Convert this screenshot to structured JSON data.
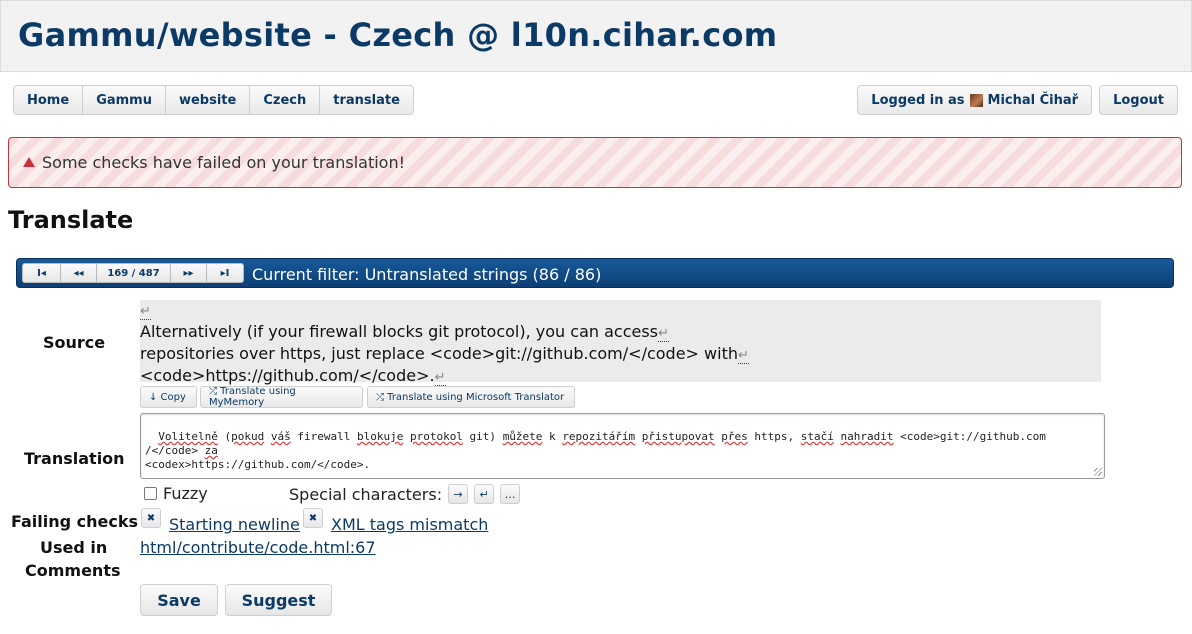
{
  "header": {
    "title": "Gammu/website - Czech @ l10n.cihar.com"
  },
  "breadcrumb": [
    "Home",
    "Gammu",
    "website",
    "Czech",
    "translate"
  ],
  "user": {
    "logged_in_prefix": "Logged in as",
    "name": "Michal Čihař",
    "logout": "Logout"
  },
  "alert": {
    "text": "Some checks have failed on your translation!"
  },
  "page_title": "Translate",
  "pager": {
    "first": "I◂",
    "prev": "◂◂",
    "position": "169 / 487",
    "next": "▸▸",
    "last": "▸I",
    "filter": "Current filter: Untranslated strings (86 / 86)"
  },
  "labels": {
    "source": "Source",
    "translation": "Translation",
    "failing_checks": "Failing checks",
    "used_in": "Used in",
    "comments": "Comments"
  },
  "source": {
    "line0": "",
    "line1": "Alternatively (if your firewall blocks git protocol), you can access",
    "line2": "repositories over https, just replace <code>git://github.com/</code> with",
    "line3": "<code>https://github.com/</code>.",
    "newline_symbol": "↵"
  },
  "source_tools": {
    "copy": "↓ Copy",
    "mymemory": "⤮ Translate using MyMemory",
    "microsoft": "⤮ Translate using Microsoft Translator"
  },
  "translation": {
    "text_parts": [
      "Volitelně",
      " (",
      "pokud",
      " ",
      "váš",
      " firewall ",
      "blokuje",
      " ",
      "protokol",
      " git) ",
      "můžete",
      " k ",
      "repozitářím",
      " ",
      "přistupovat",
      " ",
      "přes",
      " https, ",
      "stačí",
      " ",
      "nahradit",
      " <code>git://github.com\n/</code> ",
      "za",
      "\n<codex>https://github.com/</code>."
    ],
    "misspelled_indices": [
      0,
      2,
      4,
      6,
      8,
      10,
      12,
      14,
      16,
      18,
      20,
      22
    ]
  },
  "fuzzy": {
    "label": "Fuzzy",
    "checked": false
  },
  "special_chars": {
    "label": "Special characters:",
    "buttons": [
      "→",
      "↵",
      "..."
    ]
  },
  "checks": [
    {
      "dismiss": "✖",
      "name": "Starting newline"
    },
    {
      "dismiss": "✖",
      "name": "XML tags mismatch"
    }
  ],
  "used_in": "html/contribute/code.html:67",
  "actions": {
    "save": "Save",
    "suggest": "Suggest"
  },
  "colors": {
    "brand": "#0b3a66",
    "alert_border": "#c8313c",
    "pager_bg": "#0d3f74"
  }
}
